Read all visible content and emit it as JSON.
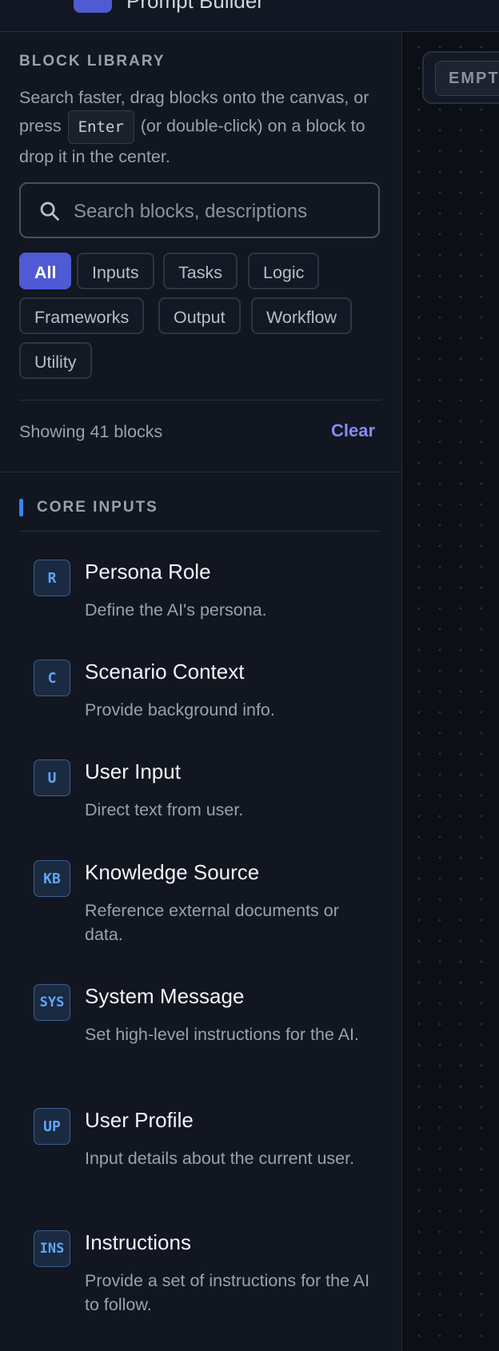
{
  "header": {
    "title_fragment": "Prompt Builder"
  },
  "library": {
    "title": "BLOCK LIBRARY",
    "desc_before": "Search faster, drag blocks onto the canvas, or press ",
    "desc_key": "Enter",
    "desc_after": " (or double-click) on a block to drop it in the center.",
    "search_placeholder": "Search blocks, descriptions",
    "search_value": "",
    "filters": [
      "All",
      "Inputs",
      "Tasks",
      "Logic",
      "Frameworks",
      "Output",
      "Workflow",
      "Utility"
    ],
    "active_filter": "All",
    "showing_text": "Showing 41 blocks",
    "clear_label": "Clear"
  },
  "section": {
    "title": "CORE INPUTS",
    "accent_color": "#3b82f6",
    "blocks": [
      {
        "badge": "R",
        "name": "Persona Role",
        "desc": "Define the AI's persona."
      },
      {
        "badge": "C",
        "name": "Scenario Context",
        "desc": "Provide background info."
      },
      {
        "badge": "U",
        "name": "User Input",
        "desc": "Direct text from user."
      },
      {
        "badge": "KB",
        "name": "Knowledge Source",
        "desc": "Reference external documents or data."
      },
      {
        "badge": "SYS",
        "name": "System Message",
        "desc": "Set high-level instructions for the AI."
      },
      {
        "badge": "UP",
        "name": "User Profile",
        "desc": "Input details about the current user."
      },
      {
        "badge": "INS",
        "name": "Instructions",
        "desc": "Provide a set of instructions for the AI to follow."
      }
    ]
  },
  "canvas": {
    "empty_label": "EMPTY"
  },
  "colors": {
    "accent": "#4f5bd5",
    "link": "#818cf8",
    "badge_text": "#60a5fa"
  }
}
